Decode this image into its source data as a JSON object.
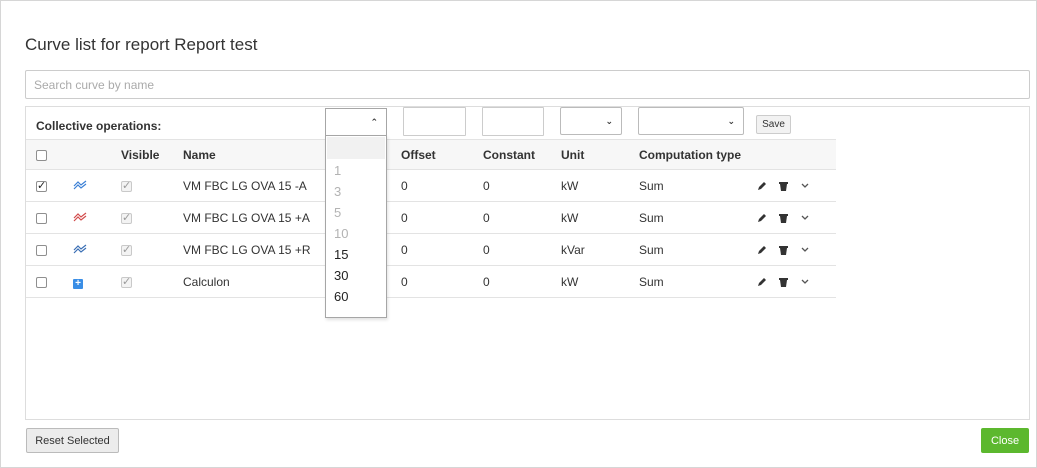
{
  "modal": {
    "title": "Curve list for report Report test"
  },
  "search": {
    "placeholder": "Search curve by name",
    "value": ""
  },
  "collective": {
    "label": "Collective operations:",
    "save_label": "Save",
    "offset_value": "",
    "constant_value": "",
    "unit_value": "",
    "computation_value": ""
  },
  "table": {
    "headers": {
      "visible": "Visible",
      "name": "Name",
      "offset": "Offset",
      "constant": "Constant",
      "unit": "Unit",
      "computation": "Computation type"
    },
    "rows": [
      {
        "selected": true,
        "icon": "curve-icon",
        "icon_color": "#3a7fd5",
        "visible": true,
        "name": "VM FBC LG OVA 15 -A",
        "offset": "0",
        "constant": "0",
        "unit": "kW",
        "computation": "Sum"
      },
      {
        "selected": false,
        "icon": "curve-icon",
        "icon_color": "#d24b4b",
        "visible": true,
        "name": "VM FBC LG OVA 15 +A",
        "offset": "0",
        "constant": "0",
        "unit": "kW",
        "computation": "Sum"
      },
      {
        "selected": false,
        "icon": "curve-icon",
        "icon_color": "#3a6fb5",
        "visible": true,
        "name": "VM FBC LG OVA 15 +R",
        "offset": "0",
        "constant": "0",
        "unit": "kVar",
        "computation": "Sum"
      },
      {
        "selected": false,
        "icon": "plus-square-icon",
        "icon_color": "#3a8ee6",
        "visible": true,
        "name": "Calculon",
        "offset": "0",
        "constant": "0",
        "unit": "kW",
        "computation": "Sum"
      }
    ]
  },
  "interval_dropdown": {
    "options": [
      {
        "label": "1",
        "disabled": true
      },
      {
        "label": "3",
        "disabled": true
      },
      {
        "label": "5",
        "disabled": true
      },
      {
        "label": "10",
        "disabled": true
      },
      {
        "label": "15",
        "disabled": false
      },
      {
        "label": "30",
        "disabled": false
      },
      {
        "label": "60",
        "disabled": false
      }
    ]
  },
  "footer": {
    "reset_label": "Reset Selected",
    "close_label": "Close"
  },
  "colors": {
    "close_button": "#5cb82e",
    "accent": "#3a8ee6"
  }
}
